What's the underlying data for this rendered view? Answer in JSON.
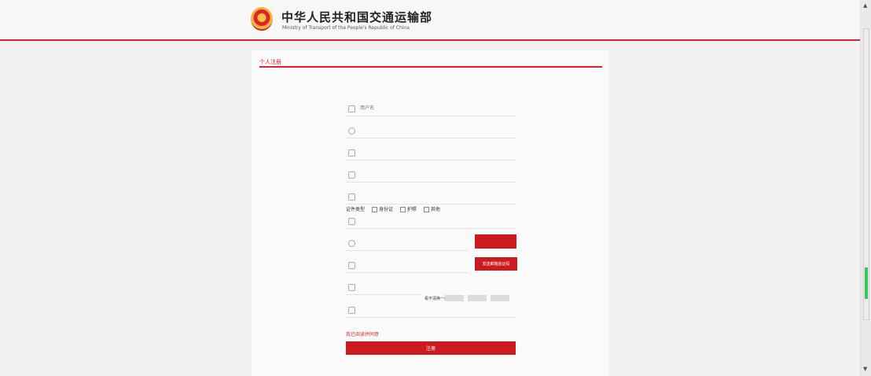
{
  "header": {
    "title": "中华人民共和国交通运输部",
    "subtitle": "Ministry of Transport of the People's Republic of China"
  },
  "form": {
    "section_title": "个人注册",
    "fields": {
      "username_placeholder": "用户名",
      "realname_placeholder": "",
      "idcard_placeholder": "",
      "phone_placeholder": "",
      "email_placeholder": "",
      "org_placeholder": "",
      "sms_placeholder": "",
      "email_code_placeholder": "",
      "captcha_input_placeholder": "",
      "password_placeholder": ""
    },
    "gender": {
      "label": "证件类型",
      "options": [
        "身份证",
        "护照",
        "其他"
      ]
    },
    "sms_button": "",
    "email_code_button": "发送邮箱验证码",
    "captcha": {
      "label": "看不清换一张",
      "slots": [
        "",
        "",
        ""
      ]
    },
    "agreement": "我已阅读并同意",
    "submit_button": "注册"
  }
}
